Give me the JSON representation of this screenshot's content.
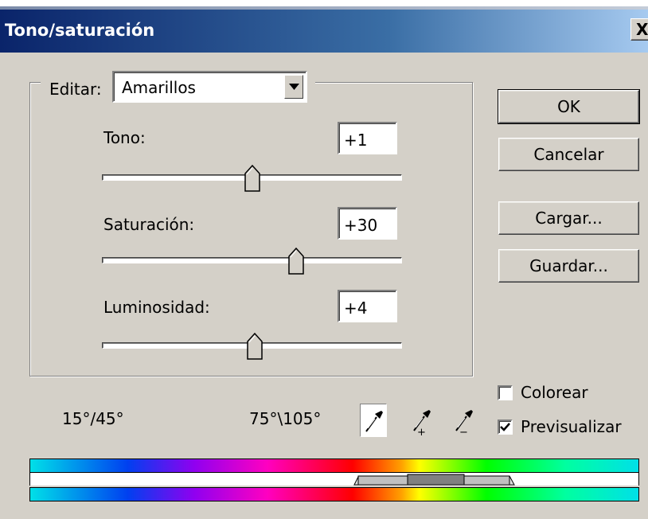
{
  "window": {
    "title": "Tono/saturación",
    "close_label": "X"
  },
  "edit": {
    "label": "Editar:",
    "selected": "Amarillos"
  },
  "sliders": [
    {
      "label": "Tono:",
      "value": "+1"
    },
    {
      "label": "Saturación:",
      "value": "+30"
    },
    {
      "label": "Luminosidad:",
      "value": "+4"
    }
  ],
  "buttons": {
    "ok": "OK",
    "cancel": "Cancelar",
    "load": "Cargar...",
    "save": "Guardar..."
  },
  "checkboxes": {
    "colorize": {
      "label": "Colorear",
      "checked": false
    },
    "preview": {
      "label": "Previsualizar",
      "checked": true
    }
  },
  "range": {
    "left": "15°/45°",
    "right": "75°\\105°"
  },
  "icons": [
    "eyedropper-icon",
    "eyedropper-plus-icon",
    "eyedropper-minus-icon"
  ]
}
